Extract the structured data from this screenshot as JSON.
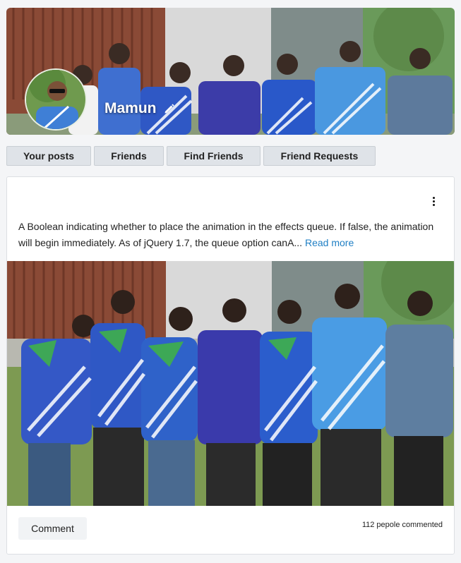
{
  "profile": {
    "name": "Mamun",
    "edit_icon": "pencil-icon"
  },
  "tabs": [
    {
      "label": "Your posts"
    },
    {
      "label": "Friends"
    },
    {
      "label": "Find Friends"
    },
    {
      "label": "Friend Requests"
    }
  ],
  "post": {
    "menu_icon": "vertical-dots-icon",
    "text": "A Boolean indicating whether to place the animation in the effects queue. If false, the animation will begin immediately. As of jQuery 1.7, the queue option canA...",
    "read_more": "Read more",
    "comment_button": "Comment",
    "comment_count": "112 pepole commented"
  },
  "colors": {
    "accent": "#1f7fc4",
    "tab_bg": "#dfe3e8"
  }
}
